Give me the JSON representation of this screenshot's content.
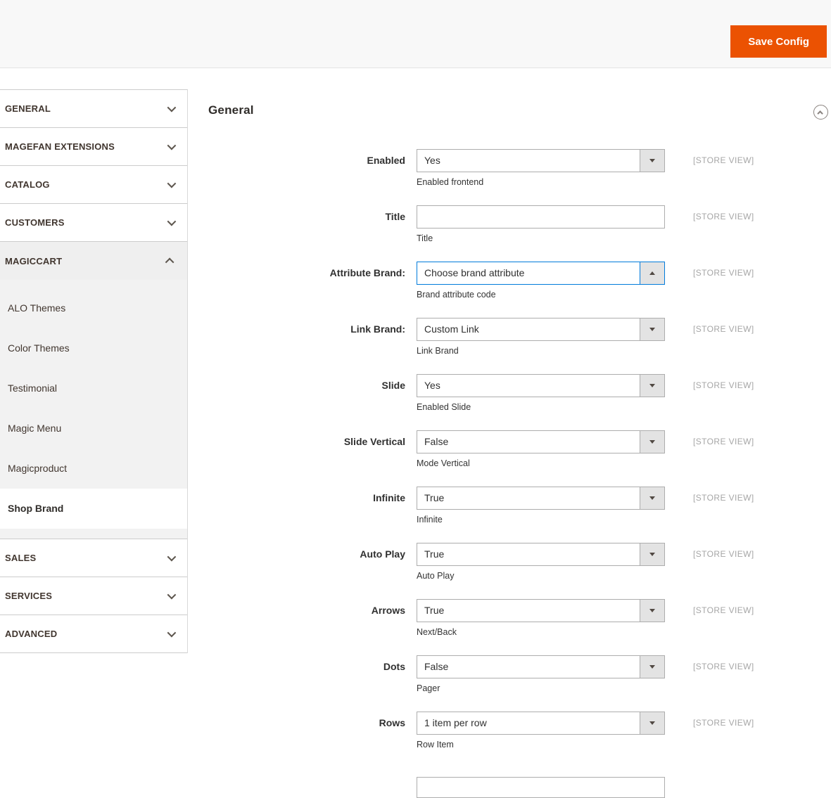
{
  "colors": {
    "accent": "#eb5202",
    "focus": "#007bdb"
  },
  "header": {
    "save_button": "Save Config"
  },
  "sidebar": {
    "top_sections": [
      "GENERAL",
      "MAGEFAN EXTENSIONS",
      "CATALOG",
      "CUSTOMERS"
    ],
    "expanded": {
      "label": "MAGICCART",
      "items": [
        "ALO Themes",
        "Color Themes",
        "Testimonial",
        "Magic Menu",
        "Magicproduct",
        "Shop Brand"
      ],
      "active": "Shop Brand"
    },
    "bottom_sections": [
      "SALES",
      "SERVICES",
      "ADVANCED"
    ]
  },
  "main": {
    "section_title": "General",
    "scope_label": "[STORE VIEW]",
    "rows": [
      {
        "label": "Enabled",
        "type": "select",
        "value": "Yes",
        "note": "Enabled frontend",
        "focused": false
      },
      {
        "label": "Title",
        "type": "text",
        "value": "",
        "note": "Title",
        "focused": false
      },
      {
        "label": "Attribute Brand:",
        "type": "select",
        "value": "Choose brand attribute",
        "note": "Brand attribute code",
        "focused": true
      },
      {
        "label": "Link Brand:",
        "type": "select",
        "value": "Custom Link",
        "note": "Link Brand",
        "focused": false
      },
      {
        "label": "Slide",
        "type": "select",
        "value": "Yes",
        "note": "Enabled Slide",
        "focused": false
      },
      {
        "label": "Slide Vertical",
        "type": "select",
        "value": "False",
        "note": "Mode Vertical",
        "focused": false
      },
      {
        "label": "Infinite",
        "type": "select",
        "value": "True",
        "note": "Infinite",
        "focused": false
      },
      {
        "label": "Auto Play",
        "type": "select",
        "value": "True",
        "note": "Auto Play",
        "focused": false
      },
      {
        "label": "Arrows",
        "type": "select",
        "value": "True",
        "note": "Next/Back",
        "focused": false
      },
      {
        "label": "Dots",
        "type": "select",
        "value": "False",
        "note": "Pager",
        "focused": false
      },
      {
        "label": "Rows",
        "type": "select",
        "value": "1 item per row",
        "note": "Row Item",
        "focused": false
      }
    ]
  }
}
